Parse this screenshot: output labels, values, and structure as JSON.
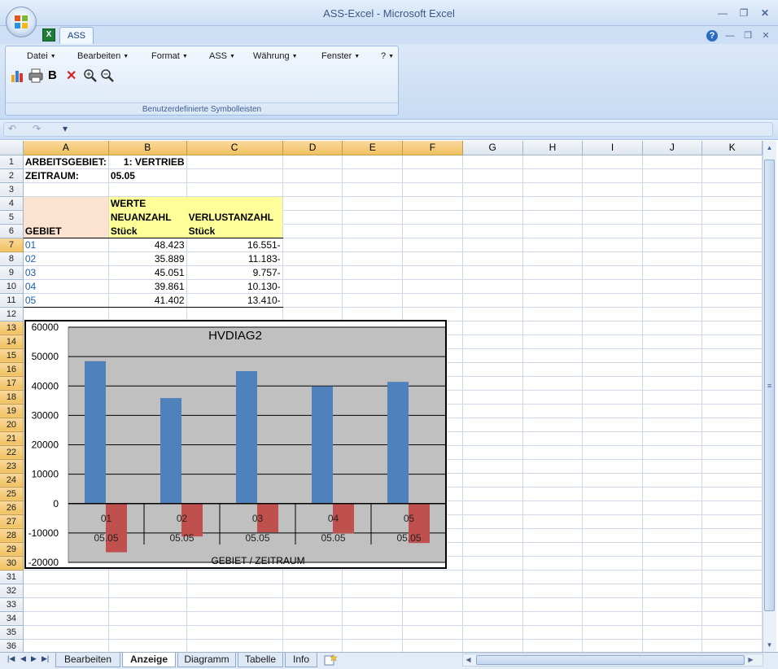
{
  "window": {
    "title": "ASS-Excel - Microsoft Excel"
  },
  "tabs": {
    "ass": "ASS"
  },
  "menu": [
    "Datei",
    "Bearbeiten",
    "Format",
    "ASS",
    "Währung",
    "Fenster",
    "?"
  ],
  "toolbar": {
    "bold_label": "B",
    "icons": [
      "chart-icon",
      "print-icon",
      "bold-icon",
      "delete-icon",
      "zoom-in-icon",
      "zoom-out-icon"
    ],
    "group_label": "Benutzerdefinierte Symbolleisten"
  },
  "quick_access": {
    "undo": "↶",
    "redo": "↷",
    "customize": "▾"
  },
  "columns": [
    "A",
    "B",
    "C",
    "D",
    "E",
    "F",
    "G",
    "H",
    "I",
    "J",
    "K"
  ],
  "cells": {
    "r1": {
      "a": "ARBEITSGEBIET:",
      "b": "1: VERTRIEB"
    },
    "r2": {
      "a": "ZEITRAUM:",
      "b": "05.05"
    },
    "r4": {
      "b": "WERTE"
    },
    "r5": {
      "b": "NEUANZAHL",
      "c": "VERLUSTANZAHL"
    },
    "r6": {
      "a": "GEBIET",
      "b": "Stück",
      "c": "Stück"
    },
    "rows": [
      {
        "gebiet": "01",
        "neu": "48.423",
        "verlust": "16.551-"
      },
      {
        "gebiet": "02",
        "neu": "35.889",
        "verlust": "11.183-"
      },
      {
        "gebiet": "03",
        "neu": "45.051",
        "verlust": "9.757-"
      },
      {
        "gebiet": "04",
        "neu": "39.861",
        "verlust": "10.130-"
      },
      {
        "gebiet": "05",
        "neu": "41.402",
        "verlust": "13.410-"
      }
    ]
  },
  "chart_data": {
    "type": "bar",
    "title": "HVDIAG2",
    "xlabel": "GEBIET / ZEITRAUM",
    "ylabel": "",
    "categories": [
      "01",
      "02",
      "03",
      "04",
      "05"
    ],
    "subcategories": [
      "05.05",
      "05.05",
      "05.05",
      "05.05",
      "05.05"
    ],
    "series": [
      {
        "values": [
          48423,
          35889,
          45051,
          39861,
          41402
        ],
        "color": "#4f81bd"
      },
      {
        "values": [
          -16551,
          -11183,
          -9757,
          -10130,
          -13410
        ],
        "color": "#c0504d"
      }
    ],
    "ylim": [
      -20000,
      60000
    ],
    "yticks": [
      60000,
      50000,
      40000,
      30000,
      20000,
      10000,
      0,
      -10000,
      -20000
    ],
    "grid": true,
    "plot_background": "#c0c0c0"
  },
  "sheet_tabs": [
    "Bearbeiten",
    "Anzeige",
    "Diagramm",
    "Tabelle",
    "Info"
  ],
  "active_sheet": "Anzeige",
  "colors": {
    "accent": "#f1c15f",
    "header_yellow": "#ffff99"
  }
}
